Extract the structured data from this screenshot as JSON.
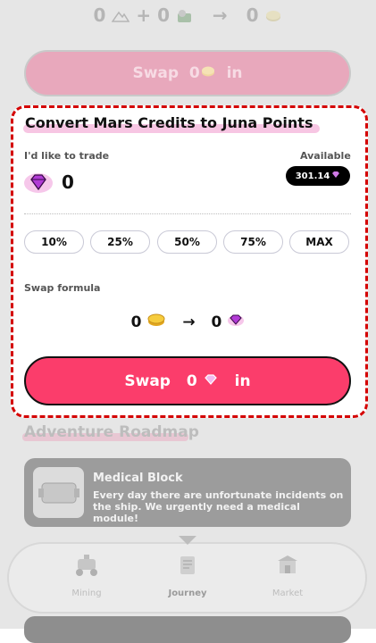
{
  "top_formula": {
    "left_a": "0",
    "plus": "+",
    "left_b": "0",
    "arrow": "→",
    "right": "0"
  },
  "top_swap": {
    "label": "Swap",
    "amount": "0",
    "suffix": "in"
  },
  "card": {
    "title": "Convert Mars Credits to Juna Points",
    "trade_label": "I'd like to trade",
    "amount": "0",
    "available_label": "Available",
    "available_value": "301.14",
    "percent_buttons": [
      "10%",
      "25%",
      "50%",
      "75%",
      "MAX"
    ],
    "formula_label": "Swap formula",
    "formula": {
      "left": "0",
      "arrow": "→",
      "right": "0"
    },
    "swap_button": {
      "label": "Swap",
      "amount": "0",
      "suffix": "in"
    }
  },
  "roadmap": {
    "title": "Adventure Roadmap",
    "item": {
      "title": "Medical Block",
      "description": "Every day there are unfortunate incidents on the ship. We urgently need a medical module!"
    }
  },
  "nav": {
    "items": [
      {
        "label": "Mining",
        "icon": "rover-icon"
      },
      {
        "label": "Journey",
        "icon": "scroll-icon"
      },
      {
        "label": "Market",
        "icon": "shop-icon"
      }
    ]
  },
  "colors": {
    "accent": "#fb3d6b",
    "gem": "#b23bd6",
    "coin": "#f2c23a"
  }
}
